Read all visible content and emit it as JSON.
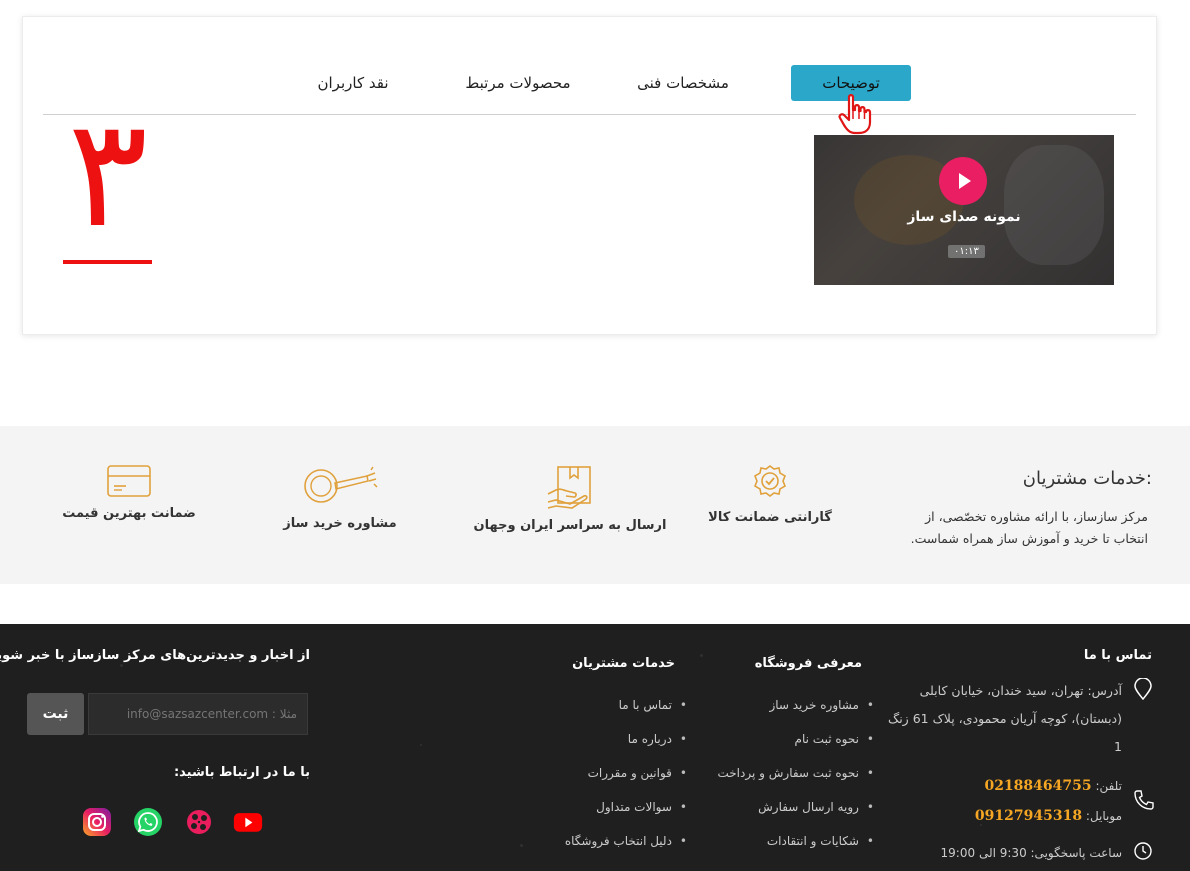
{
  "tabs": {
    "items": [
      {
        "label": "توضیحات",
        "active": true
      },
      {
        "label": "مشخصات فنی",
        "active": false
      },
      {
        "label": "محصولات مرتبط",
        "active": false
      },
      {
        "label": "نقد کاربران",
        "active": false
      }
    ]
  },
  "video": {
    "title": "نمونه صدای ساز",
    "duration": "۰۱:۱۳"
  },
  "annotation": {
    "number": "۳"
  },
  "services": {
    "title": "خدمات مشتریان:",
    "description": "مرکز سازساز، با ارائه مشاوره تخصّصی، از انتخاب تا خرید و آموزش ساز همراه شماست.",
    "items": [
      {
        "label": "گارانتی ضمانت کالا",
        "icon": "badge-check-icon"
      },
      {
        "label": "ارسال به سراسر ایران وجهان",
        "icon": "package-hand-icon"
      },
      {
        "label": "مشاوره خرید ساز",
        "icon": "instrument-icon"
      },
      {
        "label": "ضمانت بهترین قیمت",
        "icon": "credit-card-icon"
      }
    ],
    "accent": "#e0a13c"
  },
  "footer": {
    "contact": {
      "heading": "تماس با ما",
      "address": "آدرس: تهران، سید خندان، خیابان کابلی (دبستان)، کوچه آریان محمودی، پلاک 61 زنگ 1",
      "phone_label": "تلفن:",
      "phone": "02188464755",
      "mobile_label": "موبایل:",
      "mobile": "09127945318",
      "hours": "ساعت پاسخگویی: 9:30 الی 19:00"
    },
    "intro": {
      "heading": "معرفی فروشگاه",
      "items": [
        "مشاوره خرید ساز",
        "نحوه ثبت نام",
        "نحوه ثبت سفارش و پرداخت",
        "رویه ارسال سفارش",
        "شکایات و انتقادات"
      ]
    },
    "services": {
      "heading": "خدمات مشتریان",
      "items": [
        "تماس با ما",
        "درباره ما",
        "قوانین و مقررات",
        "سوالات متداول",
        "دلیل انتخاب فروشگاه"
      ]
    },
    "newsletter": {
      "heading": "از اخبار و جدیدترین‌های مرکز سازساز با خبر شوید:",
      "placeholder": "مثلا : info@sazsazcenter.com",
      "button": "ثبت"
    },
    "social": {
      "heading": "با ما در ارتباط باشید:",
      "items": [
        "instagram-icon",
        "whatsapp-icon",
        "aparat-icon",
        "youtube-icon"
      ]
    },
    "accent": "#f5a623"
  }
}
